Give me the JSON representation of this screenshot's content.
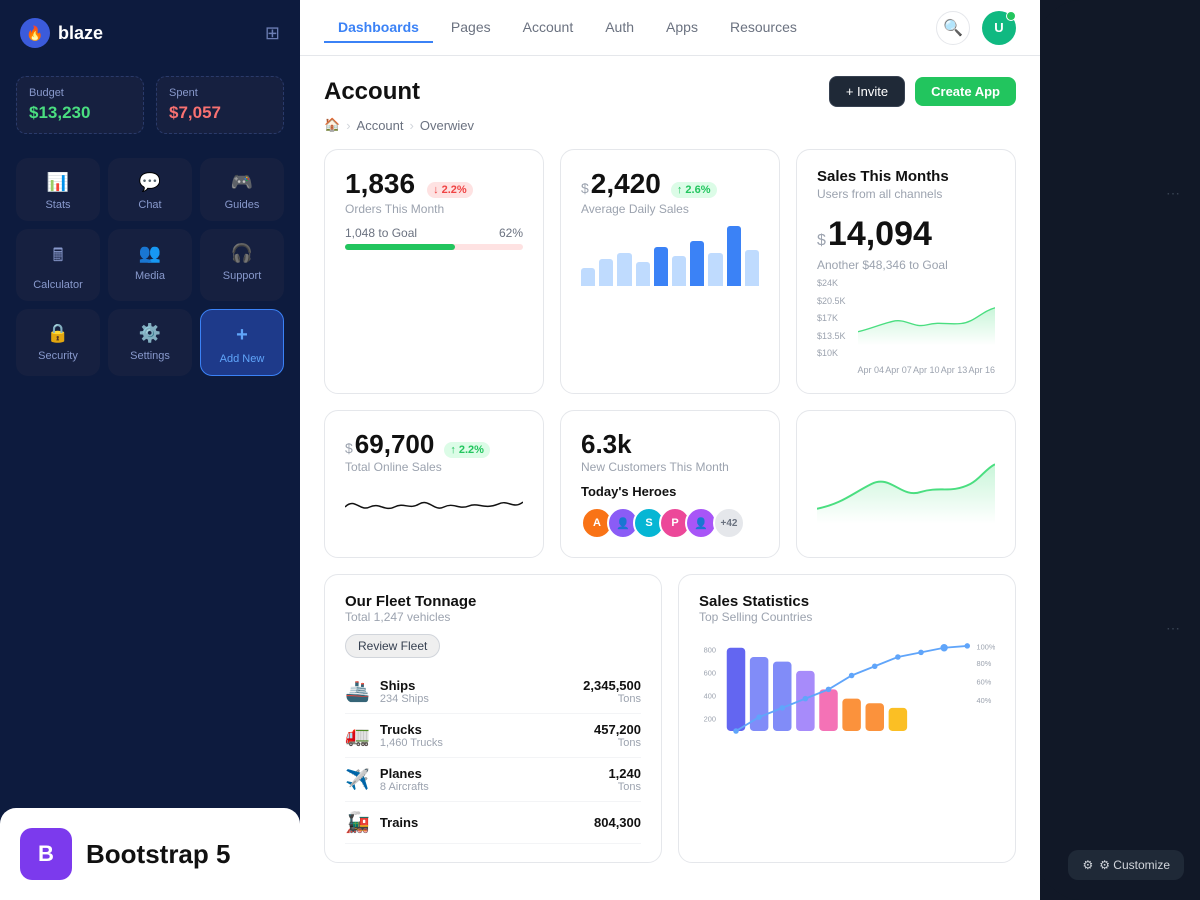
{
  "sidebar": {
    "logo": "blaze",
    "budget": {
      "label": "Budget",
      "amount": "$13,230"
    },
    "spent": {
      "label": "Spent",
      "amount": "$7,057"
    },
    "nav_items": [
      {
        "label": "Stats",
        "icon": "📊"
      },
      {
        "label": "Chat",
        "icon": "💬"
      },
      {
        "label": "Guides",
        "icon": "🎮"
      },
      {
        "label": "Calculator",
        "icon": "🖩"
      },
      {
        "label": "Media",
        "icon": "👥"
      },
      {
        "label": "Support",
        "icon": "🎧"
      },
      {
        "label": "Security",
        "icon": "🔒"
      },
      {
        "label": "Settings",
        "icon": "⚙️"
      },
      {
        "label": "Add New",
        "icon": "+"
      }
    ],
    "bootstrap_label": "Bootstrap 5"
  },
  "topnav": {
    "links": [
      "Dashboards",
      "Pages",
      "Account",
      "Auth",
      "Apps",
      "Resources"
    ],
    "active": "Dashboards",
    "invite_label": "+ Invite",
    "create_label": "Create App"
  },
  "page": {
    "title": "Account",
    "breadcrumb": [
      "🏠",
      "Account",
      "Overwiev"
    ]
  },
  "stats": [
    {
      "value": "1,836",
      "label": "Orders This Month",
      "badge": "↓ 2.2%",
      "badge_type": "red",
      "progress_label": "1,048 to Goal",
      "progress_pct": "62%",
      "progress_val": 62
    },
    {
      "prefix": "$",
      "value": "2,420",
      "label": "Average Daily Sales",
      "badge": "↑ 2.6%",
      "badge_type": "green",
      "bars": [
        30,
        45,
        55,
        40,
        65,
        50,
        75,
        55,
        80,
        60
      ]
    },
    {
      "title": "Sales This Months",
      "subtitle": "Users from all channels",
      "main_value": "14,094",
      "goal": "Another $48,346 to Goal",
      "y_labels": [
        "$24K",
        "$20.5K",
        "$17K",
        "$13.5K",
        "$10K"
      ],
      "x_labels": [
        "Apr 04",
        "Apr 07",
        "Apr 10",
        "Apr 13",
        "Apr 16"
      ]
    }
  ],
  "stats2": [
    {
      "prefix": "$",
      "value": "69,700",
      "badge": "↑ 2.2%",
      "badge_type": "green",
      "label": "Total Online Sales"
    },
    {
      "value": "6.3k",
      "label": "New Customers This Month",
      "heroes_title": "Today's Heroes",
      "heroes": [
        "A",
        "S",
        "P",
        "+42"
      ]
    }
  ],
  "fleet": {
    "title": "Our Fleet Tonnage",
    "subtitle": "Total 1,247 vehicles",
    "review_label": "Review Fleet",
    "rows": [
      {
        "icon": "🚢",
        "name": "Ships",
        "sub": "234 Ships",
        "value": "2,345,500",
        "unit": "Tons"
      },
      {
        "icon": "🚛",
        "name": "Trucks",
        "sub": "1,460 Trucks",
        "value": "457,200",
        "unit": "Tons"
      },
      {
        "icon": "✈️",
        "name": "Planes",
        "sub": "8 Aircrafts",
        "value": "1,240",
        "unit": "Tons"
      },
      {
        "icon": "🚂",
        "name": "Trains",
        "sub": "",
        "value": "804,300",
        "unit": ""
      }
    ]
  },
  "sales_stats": {
    "title": "Sales Statistics",
    "subtitle": "Top Selling Countries"
  },
  "customize": {
    "label": "⚙ Customize"
  }
}
